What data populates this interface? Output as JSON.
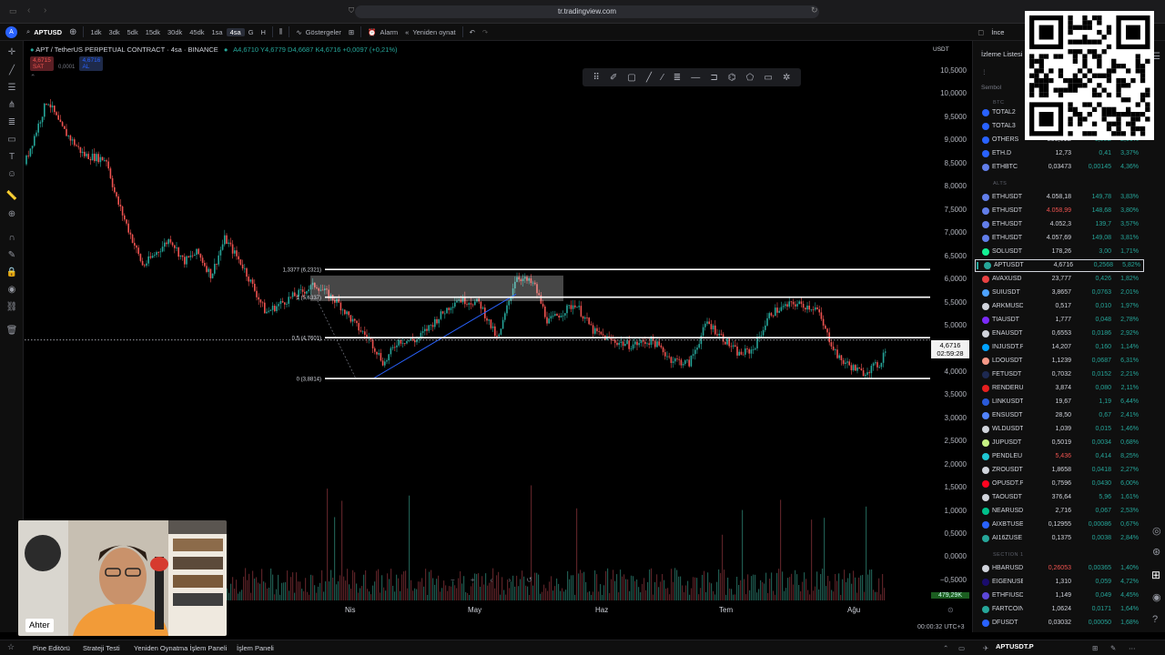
{
  "browser": {
    "url": "tr.tradingview.com"
  },
  "toolbar": {
    "symbol": "APTUSD",
    "timeframes": [
      "1dk",
      "3dk",
      "5dk",
      "15dk",
      "30dk",
      "45dk",
      "1sa",
      "4sa",
      "G",
      "H"
    ],
    "active_timeframe": "4sa",
    "indicators_label": "Göstergeler",
    "alarm_label": "Alarm",
    "replay_label": "Yeniden oynat"
  },
  "legend": {
    "title": "APT / TetherUS PERPETUAL CONTRACT · 4sa · BINANCE",
    "ohlc": "A4,6710 Y4,6779 D4,6687 K4,6716 +0,0097 (+0,21%)",
    "sell_price": "4,6715",
    "sell_label": "SAT",
    "spread": "0,0001",
    "buy_price": "4,6716",
    "buy_label": "AL"
  },
  "price_axis": {
    "currency": "USDT",
    "ticks": [
      "10,5000",
      "10,0000",
      "9,5000",
      "9,0000",
      "8,5000",
      "8,0000",
      "7,5000",
      "7,0000",
      "6,5000",
      "6,0000",
      "5,5000",
      "5,0000",
      "4,5000",
      "4,0000",
      "3,5000",
      "3,0000",
      "2,5000",
      "2,0000",
      "1,5000",
      "1,0000",
      "0,5000",
      "0,0000",
      "−0,5000"
    ],
    "current_price": "4,6716",
    "countdown": "02:59:28",
    "volume_label": "479,29K"
  },
  "fib_levels": [
    {
      "label": "1,3377 (6,2321)",
      "value": 6.2321
    },
    {
      "label": "1 (5,6337)",
      "value": 5.6337
    },
    {
      "label": "0,5 (4,7601)",
      "value": 4.7601
    },
    {
      "label": "0 (3,8814)",
      "value": 3.8814
    }
  ],
  "time_axis": {
    "ticks": [
      "Nis",
      "May",
      "Haz",
      "Tem",
      "Ağu"
    ],
    "clock": "00:00:32 UTC+3"
  },
  "watchlist": {
    "title": "İzleme Listesi",
    "column_label": "Sembol",
    "sections": [
      "BTC",
      "ALTS",
      "SECTION 1"
    ],
    "rows_a": [
      {
        "sym": "TOTAL2",
        "last": "",
        "chg": "",
        "pct": "",
        "color": "#2962ff"
      },
      {
        "sym": "TOTAL3",
        "last": "",
        "chg": "",
        "pct": "",
        "color": "#2962ff"
      },
      {
        "sym": "OTHERS",
        "last": "298,61B",
        "chg": "6,00B",
        "pct": "2,06%",
        "color": "#2962ff"
      },
      {
        "sym": "ETH.D",
        "last": "12,73",
        "chg": "0,41",
        "pct": "3,37%",
        "color": "#2962ff"
      },
      {
        "sym": "ETHBTC",
        "last": "0,03473",
        "chg": "0,00145",
        "pct": "4,36%",
        "color": "#627eea"
      }
    ],
    "rows_b": [
      {
        "sym": "ETHUSDT",
        "last": "4.058,18",
        "chg": "149,78",
        "pct": "3,83%",
        "color": "#627eea"
      },
      {
        "sym": "ETHUSDT",
        "last": "4.058,99",
        "chg": "148,68",
        "pct": "3,80%",
        "color": "#627eea",
        "last_color": "#ef5350"
      },
      {
        "sym": "ETHUSDT",
        "last": "4.052,3",
        "chg": "139,7",
        "pct": "3,57%",
        "color": "#627eea"
      },
      {
        "sym": "ETHUSDT",
        "last": "4.057,69",
        "chg": "149,08",
        "pct": "3,81%",
        "color": "#627eea"
      },
      {
        "sym": "SOLUSDT",
        "last": "178,26",
        "chg": "3,00",
        "pct": "1,71%",
        "color": "#14f195"
      },
      {
        "sym": "APTUSDT",
        "last": "4,6716",
        "chg": "0,2568",
        "pct": "5,82%",
        "color": "#26a69a",
        "selected": true
      },
      {
        "sym": "AVAXUSD",
        "last": "23,777",
        "chg": "0,426",
        "pct": "1,82%",
        "color": "#e84142"
      },
      {
        "sym": "SUIUSDT",
        "last": "3,8657",
        "chg": "0,0763",
        "pct": "2,01%",
        "color": "#4da2ff"
      },
      {
        "sym": "ARKMUSD",
        "last": "0,517",
        "chg": "0,010",
        "pct": "1,97%",
        "color": "#d1d4dc"
      },
      {
        "sym": "TIAUSDT",
        "last": "1,777",
        "chg": "0,048",
        "pct": "2,78%",
        "color": "#7b2bf9"
      },
      {
        "sym": "ENAUSDT",
        "last": "0,6553",
        "chg": "0,0186",
        "pct": "2,92%",
        "color": "#d1d4dc"
      },
      {
        "sym": "INJUSDT.P",
        "last": "14,207",
        "chg": "0,160",
        "pct": "1,14%",
        "color": "#00a3ff"
      },
      {
        "sym": "LDOUSDT",
        "last": "1,1239",
        "chg": "0,0687",
        "pct": "6,31%",
        "color": "#f69988"
      },
      {
        "sym": "FETUSDT",
        "last": "0,7032",
        "chg": "0,0152",
        "pct": "2,21%",
        "color": "#1d2951"
      },
      {
        "sym": "RENDERU",
        "last": "3,874",
        "chg": "0,080",
        "pct": "2,11%",
        "color": "#e51f1f"
      },
      {
        "sym": "LINKUSDT",
        "last": "19,67",
        "chg": "1,19",
        "pct": "6,44%",
        "color": "#2a5ada"
      },
      {
        "sym": "ENSUSDT",
        "last": "28,50",
        "chg": "0,67",
        "pct": "2,41%",
        "color": "#5284ff"
      },
      {
        "sym": "WLDUSDT",
        "last": "1,039",
        "chg": "0,015",
        "pct": "1,46%",
        "color": "#d1d4dc"
      },
      {
        "sym": "JUPUSDT",
        "last": "0,5019",
        "chg": "0,0034",
        "pct": "0,68%",
        "color": "#c7f284"
      },
      {
        "sym": "PENDLEU",
        "last": "5,436",
        "chg": "0,414",
        "pct": "8,25%",
        "color": "#1fc7d4",
        "last_color": "#ef5350"
      },
      {
        "sym": "ZROUSDT",
        "last": "1,8658",
        "chg": "0,0418",
        "pct": "2,27%",
        "color": "#d1d4dc"
      },
      {
        "sym": "OPUSDT.P",
        "last": "0,7596",
        "chg": "0,0430",
        "pct": "6,00%",
        "color": "#ff0420"
      },
      {
        "sym": "TAOUSDT",
        "last": "376,64",
        "chg": "5,96",
        "pct": "1,61%",
        "color": "#d1d4dc"
      },
      {
        "sym": "NEARUSD",
        "last": "2,716",
        "chg": "0,067",
        "pct": "2,53%",
        "color": "#00c08b"
      },
      {
        "sym": "AIXBTUSE",
        "last": "0,12955",
        "chg": "0,00086",
        "pct": "0,67%",
        "color": "#2962ff"
      },
      {
        "sym": "AI16ZUSE",
        "last": "0,1375",
        "chg": "0,0038",
        "pct": "2,84%",
        "color": "#26a69a"
      }
    ],
    "rows_c": [
      {
        "sym": "HBARUSD",
        "last": "0,26053",
        "chg": "0,00365",
        "pct": "1,40%",
        "color": "#d1d4dc",
        "last_color": "#ef5350"
      },
      {
        "sym": "EIGENUSE",
        "last": "1,310",
        "chg": "0,059",
        "pct": "4,72%",
        "color": "#1a0c6d"
      },
      {
        "sym": "ETHFIUSD",
        "last": "1,149",
        "chg": "0,049",
        "pct": "4,45%",
        "color": "#5c47d9"
      },
      {
        "sym": "FARTCOIN",
        "last": "1,0624",
        "chg": "0,0171",
        "pct": "1,64%",
        "color": "#26a69a"
      },
      {
        "sym": "DFUSDT",
        "last": "0,03032",
        "chg": "0,00050",
        "pct": "1,68%",
        "color": "#2962ff"
      }
    ],
    "bottom_symbol": "APTUSDT.P"
  },
  "bottom_bar": {
    "items": [
      "Pine Editörü",
      "Strateji Testi",
      "Yeniden Oynatma İşlem Paneli",
      "İşlem Paneli"
    ]
  },
  "webcam": {
    "name": "Ahter"
  },
  "search_partial": "İnce",
  "colors": {
    "up": "#26a69a",
    "down": "#ef5350",
    "fib": "#ffffff",
    "trend": "#2962ff"
  }
}
